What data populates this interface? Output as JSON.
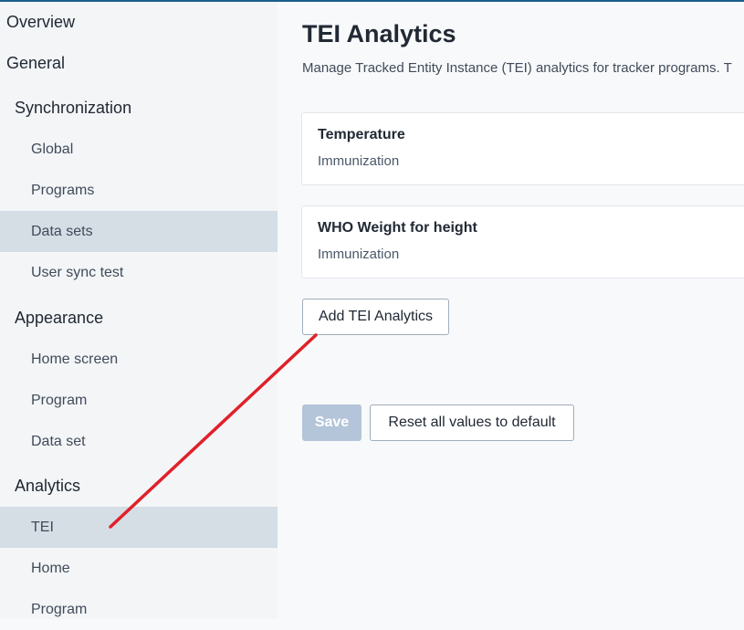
{
  "sidebar": {
    "items": [
      {
        "label": "Overview"
      },
      {
        "label": "General"
      },
      {
        "label": "Synchronization"
      },
      {
        "label": "Global"
      },
      {
        "label": "Programs"
      },
      {
        "label": "Data sets"
      },
      {
        "label": "User sync test"
      },
      {
        "label": "Appearance"
      },
      {
        "label": "Home screen"
      },
      {
        "label": "Program"
      },
      {
        "label": "Data set"
      },
      {
        "label": "Analytics"
      },
      {
        "label": "TEI"
      },
      {
        "label": "Home"
      },
      {
        "label": "Program"
      }
    ]
  },
  "main": {
    "title": "TEI Analytics",
    "description": "Manage Tracked Entity Instance (TEI) analytics for tracker programs. T",
    "cards": [
      {
        "title": "Temperature",
        "subtitle": "Immunization"
      },
      {
        "title": "WHO Weight for height",
        "subtitle": "Immunization"
      }
    ],
    "add_button": "Add TEI Analytics",
    "save_button": "Save",
    "reset_button": "Reset all values to default"
  },
  "annotation": {
    "color": "#e0202a"
  },
  "colors": {
    "active_item_bg": "#d5dde5",
    "accent_bar": "#1b5e8c",
    "disabled_button": "#b4c5d9"
  }
}
